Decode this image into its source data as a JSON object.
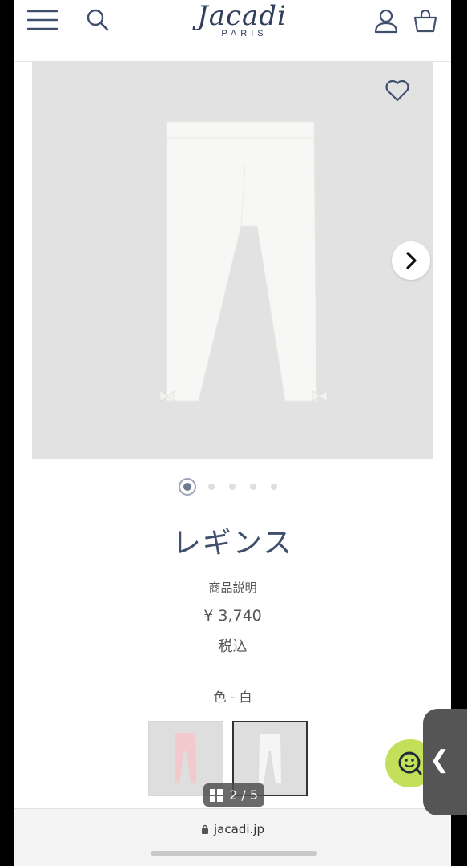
{
  "brand": {
    "logo": "Jacadi",
    "logo_sub": "PARIS"
  },
  "header": {
    "icons": [
      "menu-icon",
      "search-icon",
      "account-icon",
      "shopping-bag-icon"
    ]
  },
  "gallery": {
    "current": 2,
    "total": 5,
    "counter_label": "2 / 5",
    "active_dot_index": 0,
    "dot_count": 5
  },
  "product": {
    "name": "レギンス",
    "description_link": "商品説明",
    "price": "¥ 3,740",
    "tax_note": "税込",
    "color_label": "色 - 白",
    "swatches": [
      {
        "color": "pink",
        "selected": false
      },
      {
        "color": "white",
        "selected": true
      }
    ]
  },
  "browser": {
    "url": "jacadi.jp"
  },
  "colors": {
    "brand": "#3f4f6c",
    "chat": "#c4e05a",
    "hero_bg": "#e2e2e2"
  }
}
